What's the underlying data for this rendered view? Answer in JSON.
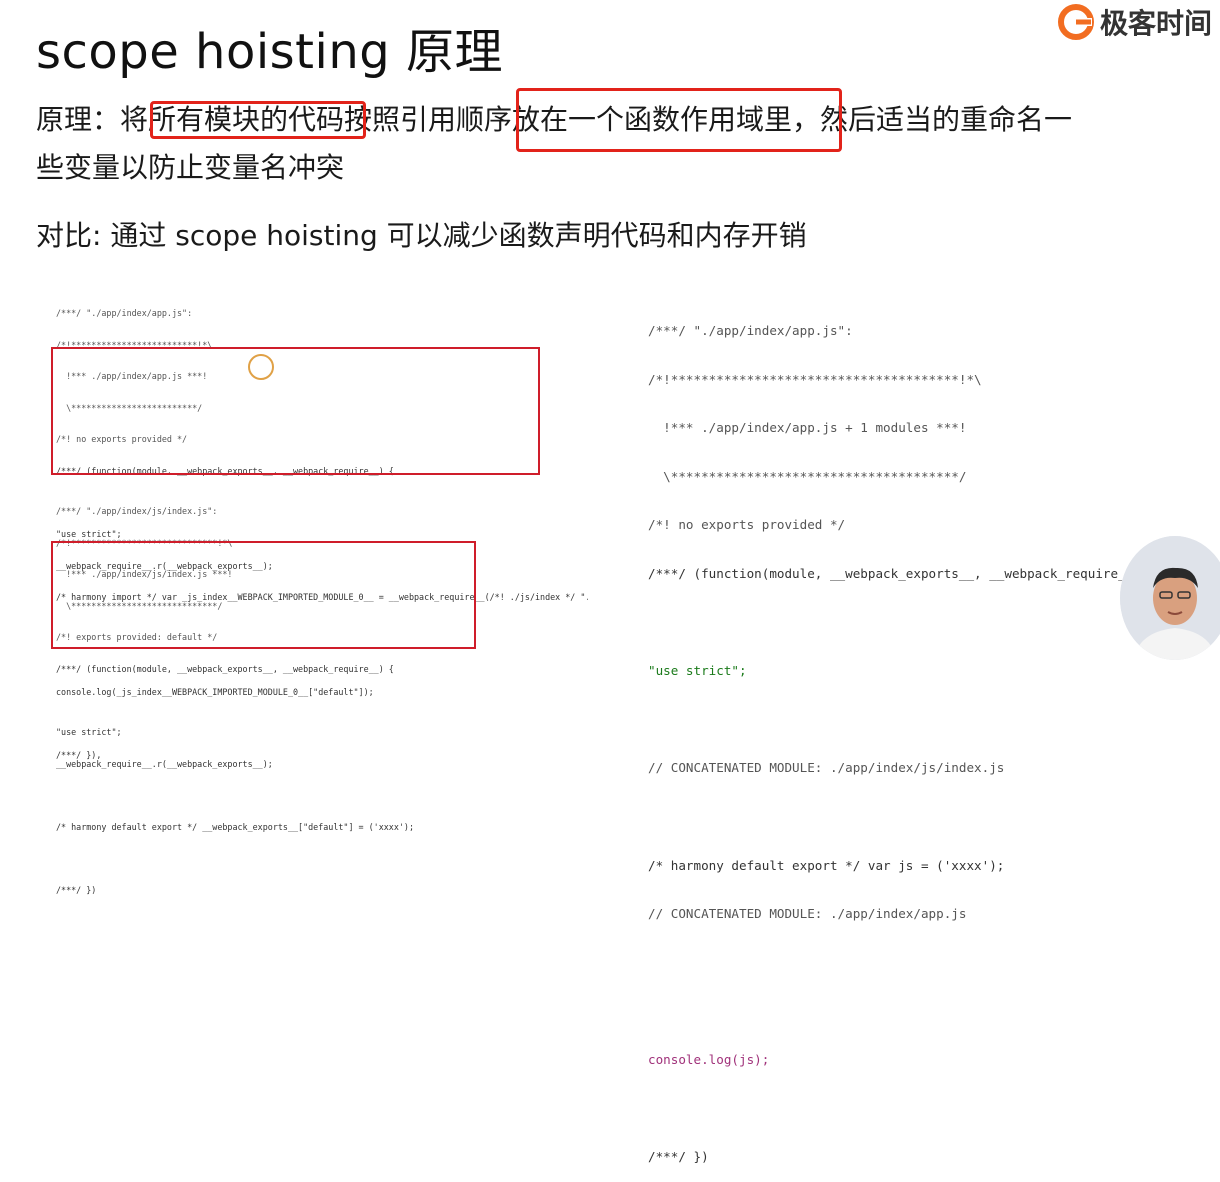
{
  "slide": {
    "title": "scope hoisting 原理",
    "logo_text": "极客时间",
    "principle_line1": "原理：将所有模块的代码按照引用顺序放在一个函数作用域里，然后适当的重命名一",
    "principle_line2": "些变量以防止变量名冲突",
    "compare_line": "对比: 通过 scope hoisting 可以减少函数声明代码和内存开销"
  },
  "left_code": {
    "block1": [
      "/***/ \"./app/index/app.js\":",
      "/*!*************************!*\\",
      "  !*** ./app/index/app.js ***!",
      "  \\*************************/",
      "/*! no exports provided */",
      "/***/ (function(module, __webpack_exports__, __webpack_require__) {",
      "",
      "\"use strict\";",
      "__webpack_require__.r(__webpack_exports__);",
      "/* harmony import */ var _js_index__WEBPACK_IMPORTED_MODULE_0__ = __webpack_require__(/*! ./js/index */ \"./app/index/js/index.js\");",
      "",
      "",
      "console.log(_js_index__WEBPACK_IMPORTED_MODULE_0__[\"default\"]);",
      "",
      "/***/ }),"
    ],
    "block2": [
      "/***/ \"./app/index/js/index.js\":",
      "/*!*****************************!*\\",
      "  !*** ./app/index/js/index.js ***!",
      "  \\*****************************/",
      "/*! exports provided: default */",
      "/***/ (function(module, __webpack_exports__, __webpack_require__) {",
      "",
      "\"use strict\";",
      "__webpack_require__.r(__webpack_exports__);",
      "",
      "/* harmony default export */ __webpack_exports__[\"default\"] = ('xxxx');",
      "",
      "/***/ })"
    ]
  },
  "right_code": [
    "/***/ \"./app/index/app.js\":",
    "/*!**************************************!*\\",
    "  !*** ./app/index/app.js + 1 modules ***!",
    "  \\**************************************/",
    "/*! no exports provided */",
    "/***/ (function(module, __webpack_exports__, __webpack_require__) {",
    "",
    "\"use strict\";",
    "",
    "// CONCATENATED MODULE: ./app/index/js/index.js",
    "",
    "/* harmony default export */ var js = ('xxxx');",
    "// CONCATENATED MODULE: ./app/index/app.js",
    "",
    "",
    "console.log(js);",
    "",
    "/***/ })"
  ],
  "colors": {
    "highlight_border": "#e2231a",
    "code_box_border": "#cf1d2a",
    "logo_accent": "#f26d21"
  },
  "icons": {
    "logo": "geektime-logo-icon",
    "cursor": "cursor-ring-icon",
    "presenter": "presenter-avatar-icon"
  }
}
